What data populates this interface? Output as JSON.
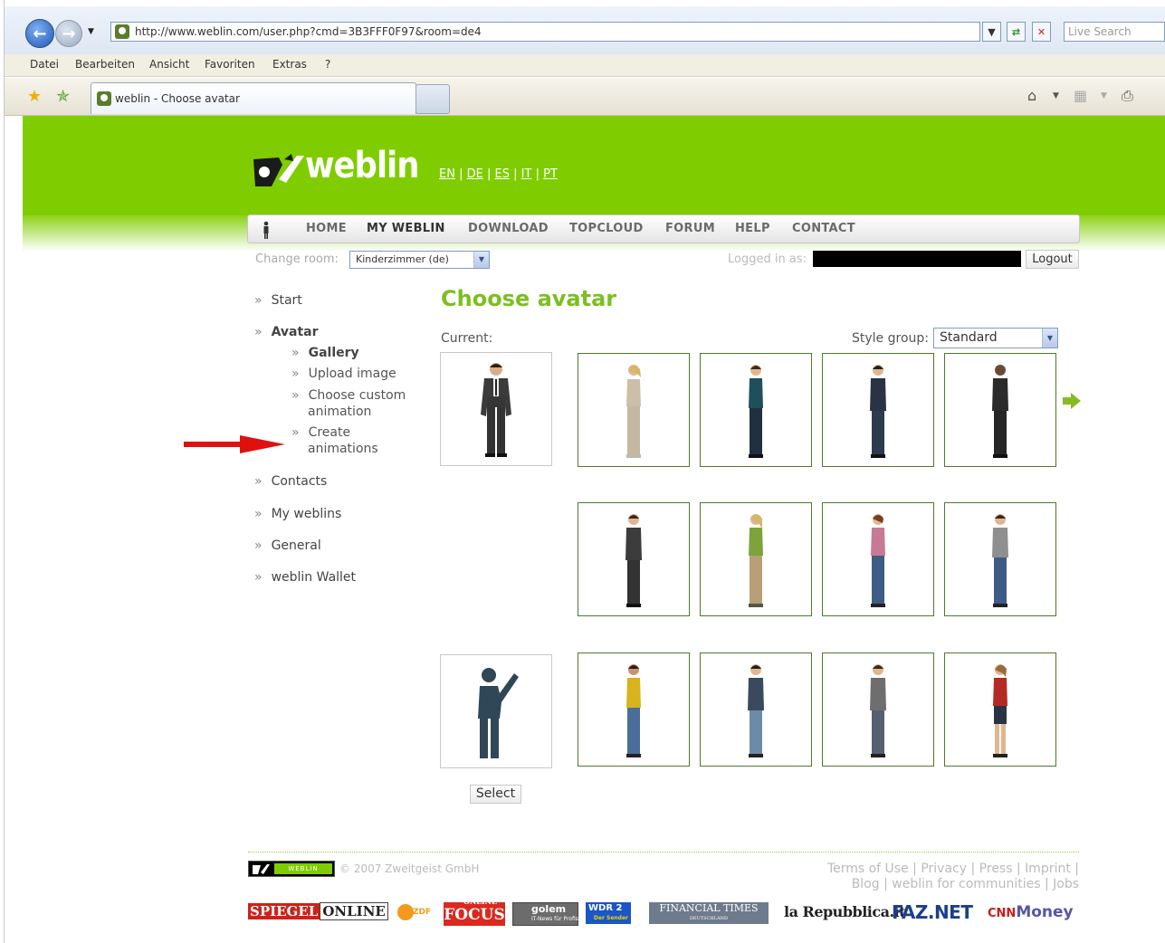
{
  "browser": {
    "url": "http://www.weblin.com/user.php?cmd=3B3FFF0F97&room=de4",
    "search_placeholder": "Live Search",
    "menu": [
      "Datei",
      "Bearbeiten",
      "Ansicht",
      "Favoriten",
      "Extras",
      "?"
    ],
    "tab_title": "weblin - Choose avatar"
  },
  "site": {
    "logo": "weblin",
    "languages": [
      "EN",
      "DE",
      "ES",
      "IT",
      "PT"
    ],
    "lang_sep": "|",
    "nav": [
      "HOME",
      "MY WEBLIN",
      "DOWNLOAD",
      "TOPCLOUD",
      "FORUM",
      "HELP",
      "CONTACT"
    ],
    "change_room_label": "Change room:",
    "room_value": "Kinderzimmer (de)",
    "logged_in_label": "Logged in as:",
    "logout_label": "Logout"
  },
  "sidebar": {
    "start": "Start",
    "avatar": "Avatar",
    "gallery": "Gallery",
    "upload": "Upload image",
    "custom1": "Choose custom",
    "custom2": "animation",
    "create1": "Create",
    "create2": "animations",
    "contacts": "Contacts",
    "myweblins": "My weblins",
    "general": "General",
    "wallet": "weblin Wallet",
    "bullet": "»"
  },
  "main": {
    "title": "Choose avatar",
    "current_label": "Current:",
    "style_group_label": "Style group:",
    "style_group_value": "Standard",
    "select_label": "Select"
  },
  "avatars": {
    "colors": {
      "grey-suit": "#3a3a3a",
      "beige": "#cbbfa8",
      "teal": "#1f4f5a",
      "navy": "#2a3344",
      "dark": "#2b2b2b",
      "charcoal": "#3c3c3c",
      "green-top": "#7da43a",
      "pink-top": "#c77a96",
      "grey-top": "#8f8f8f",
      "yellow-top": "#d9b21e",
      "denim-light": "#6b8ba6",
      "denim": "#3f5c86",
      "red-top": "#b52a25",
      "skin": "#e2b58e",
      "hair-dark": "#3b2a1e",
      "hair-blonde": "#d6b56a",
      "silhouette": "#2f4756"
    }
  },
  "footer": {
    "logo_text": "WEBLIN",
    "copyright": "© 2007 Zweitgeist GmbH",
    "links_line1": [
      "Terms of Use",
      "Privacy",
      "Press",
      "Imprint"
    ],
    "links_line2": [
      "Blog",
      "weblin for communities",
      "Jobs"
    ],
    "link_sep": "|",
    "press": {
      "spiegel_a": "SPIEGEL",
      "spiegel_b": "ONLINE",
      "zdf": "ZDF",
      "focus": "FOCUS",
      "focus_top": "ONLINE",
      "golem": "golem",
      "golem_sub": "IT-News für Profis",
      "wdr": "WDR 2",
      "wdr_sub": "Der Sender",
      "ft": "FINANCIAL TIMES",
      "ft_sub": "DEUTSCHLAND",
      "repubblica": "la Repubblica.it",
      "faz": "FAZ.NET",
      "cnn_a": "CNN",
      "cnn_b": "Money"
    }
  }
}
